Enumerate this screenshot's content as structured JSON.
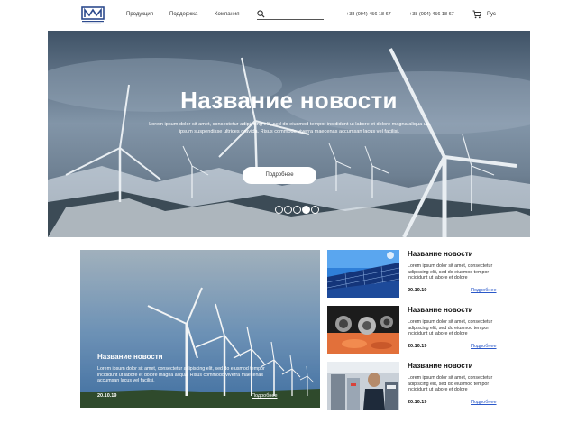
{
  "header": {
    "nav": [
      "Продукция",
      "Поддержка",
      "Компания"
    ],
    "phones": [
      "+38 (094) 456 18 67",
      "+38 (094) 456 18 67"
    ],
    "lang": "Рус"
  },
  "hero": {
    "title": "Название новости",
    "text": "Lorem ipsum dolor sit amet, consectetur adipiscing elit, sed do eiusmod tempor incididunt ut labore et dolore magna aliqua uis ipsum suspendisse ultrices gravida. Risus commodo viverra maecenas accumsan lacus vel facilisi.",
    "button": "Подробнее",
    "slides_count": 5,
    "active_slide": 4
  },
  "featured": {
    "title": "Название новости",
    "text": "Lorem ipsum dolor sit amet, consectetur adipiscing elit, sed do eiusmod tempor incididunt ut labore et dolore magna aliqua. Risus commodo viverra maecenas accumsan lacus vel facilisi.",
    "date": "20.10.19",
    "more": "Подробнее"
  },
  "side_news": [
    {
      "title": "Название новости",
      "text": "Lorem ipsum dolor sit amet, consectetur adipiscing elit, sed do eiusmod tempor incididunt ut labore et dolore",
      "date": "20.10.19",
      "more": "Подробнее"
    },
    {
      "title": "Название новости",
      "text": "Lorem ipsum dolor sit amet, consectetur adipiscing elit, sed do eiusmod tempor incididunt ut labore et dolore",
      "date": "20.10.19",
      "more": "Подробнее"
    },
    {
      "title": "Название новости",
      "text": "Lorem ipsum dolor sit amet, consectetur adipiscing elit, sed do eiusmod tempor incididunt ut labore et dolore",
      "date": "20.10.19",
      "more": "Подробнее"
    }
  ],
  "colors": {
    "link": "#2a58c9",
    "logo": "#2d4b8e"
  }
}
